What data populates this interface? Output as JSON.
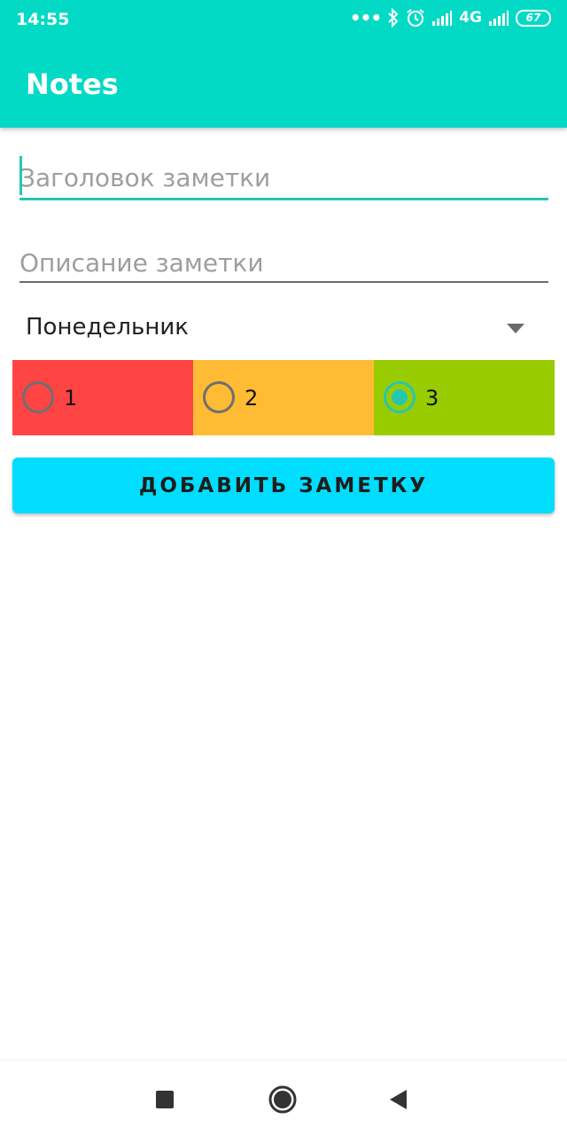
{
  "status_bar": {
    "time": "14:55",
    "dots": "•••",
    "network": "4G",
    "battery": "67"
  },
  "app_bar": {
    "title": "Notes",
    "color": "#03DAC5"
  },
  "form": {
    "title_placeholder": "Заголовок заметки",
    "title_value": "",
    "description_placeholder": "Описание заметки",
    "description_value": "",
    "day_selected": "Понедельник",
    "priority_options": [
      {
        "label": "1",
        "color": "#FF4444",
        "checked": false
      },
      {
        "label": "2",
        "color": "#FFBB33",
        "checked": false
      },
      {
        "label": "3",
        "color": "#99CC00",
        "checked": true
      }
    ],
    "add_button_label": "ДОБАВИТЬ ЗАМЕТКУ",
    "add_button_color": "#00DDFF",
    "accent_color": "#26C6B3"
  },
  "nav_bar": {
    "icons": [
      "recent-apps-icon",
      "home-icon",
      "back-icon"
    ]
  }
}
